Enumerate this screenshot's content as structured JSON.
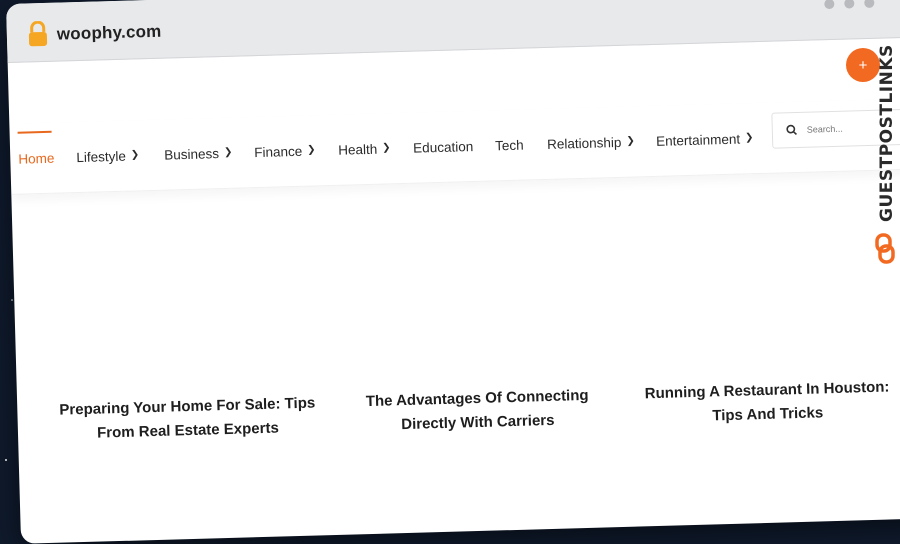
{
  "browser": {
    "url": "woophy.com"
  },
  "nav": {
    "items": [
      {
        "label": "Home",
        "has_dropdown": false,
        "active": true
      },
      {
        "label": "Lifestyle",
        "has_dropdown": true,
        "active": false
      },
      {
        "label": "Business",
        "has_dropdown": true,
        "active": false
      },
      {
        "label": "Finance",
        "has_dropdown": true,
        "active": false
      },
      {
        "label": "Health",
        "has_dropdown": true,
        "active": false
      },
      {
        "label": "Education",
        "has_dropdown": false,
        "active": false
      },
      {
        "label": "Tech",
        "has_dropdown": false,
        "active": false
      },
      {
        "label": "Relationship",
        "has_dropdown": true,
        "active": false
      },
      {
        "label": "Entertainment",
        "has_dropdown": true,
        "active": false
      }
    ],
    "search_placeholder": "Search..."
  },
  "posts": [
    {
      "title": "Preparing Your Home For Sale: Tips From Real Estate Experts"
    },
    {
      "title": "The Advantages Of Connecting Directly With Carriers"
    },
    {
      "title": "Running A Restaurant In Houston: Tips And Tricks"
    }
  ],
  "overlay": {
    "fab_symbol": "+",
    "brand_text": "GUESTPOSTLINKS"
  },
  "colors": {
    "accent": "#e8681e",
    "fab": "#f26a21",
    "lock": "#f5a623",
    "background": "#0f1a2c"
  },
  "icons": [
    "lock-icon",
    "search-icon",
    "chevron-down-icon",
    "plus-icon",
    "link-logo-icon"
  ]
}
